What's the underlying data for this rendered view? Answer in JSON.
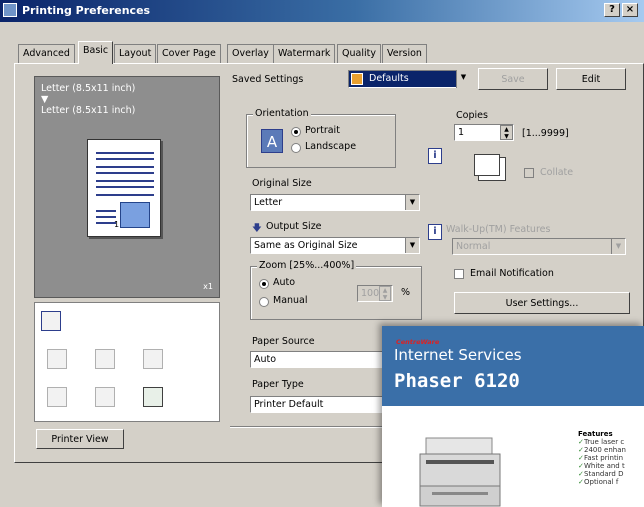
{
  "window": {
    "title": "Printing Preferences",
    "help_btn": "?",
    "close_btn": "×"
  },
  "tabs": [
    "Advanced",
    "Basic",
    "Layout",
    "Cover Page",
    "Overlay",
    "Watermark",
    "Quality",
    "Version"
  ],
  "preview": {
    "label1": "Letter (8.5x11 inch)",
    "arrow": "▼",
    "label2": "Letter (8.5x11 inch)",
    "page_num": "1",
    "copies_mark": "x1",
    "printer_view_btn": "Printer View"
  },
  "saved_settings": {
    "label": "Saved Settings",
    "value": "Defaults",
    "save_btn": "Save",
    "edit_btn": "Edit"
  },
  "orientation": {
    "title": "Orientation",
    "icon_letter": "A",
    "portrait": "Portrait",
    "landscape": "Landscape"
  },
  "original_size": {
    "label": "Original Size",
    "value": "Letter"
  },
  "output_size": {
    "label": "Output Size",
    "value": "Same as Original Size"
  },
  "zoom": {
    "title": "Zoom [25%...400%]",
    "auto": "Auto",
    "manual": "Manual",
    "value": "100",
    "unit": "%"
  },
  "paper_source": {
    "label": "Paper Source",
    "value": "Auto"
  },
  "paper_type": {
    "label": "Paper Type",
    "value": "Printer Default"
  },
  "copies": {
    "label": "Copies",
    "value": "1",
    "range": "[1...9999]",
    "collate": "Collate"
  },
  "walkup": {
    "label": "Walk-Up(TM) Features",
    "value": "Normal"
  },
  "email_notification": "Email Notification",
  "user_settings_btn": "User Settings...",
  "overlay": {
    "brand": "CentreWare",
    "service": "Internet Services",
    "model": "Phaser 6120",
    "features_title": "Features",
    "features": [
      "True laser c",
      "2400 enhan",
      "Fast printin",
      "White and t",
      "Standard D",
      "Optional f"
    ]
  }
}
